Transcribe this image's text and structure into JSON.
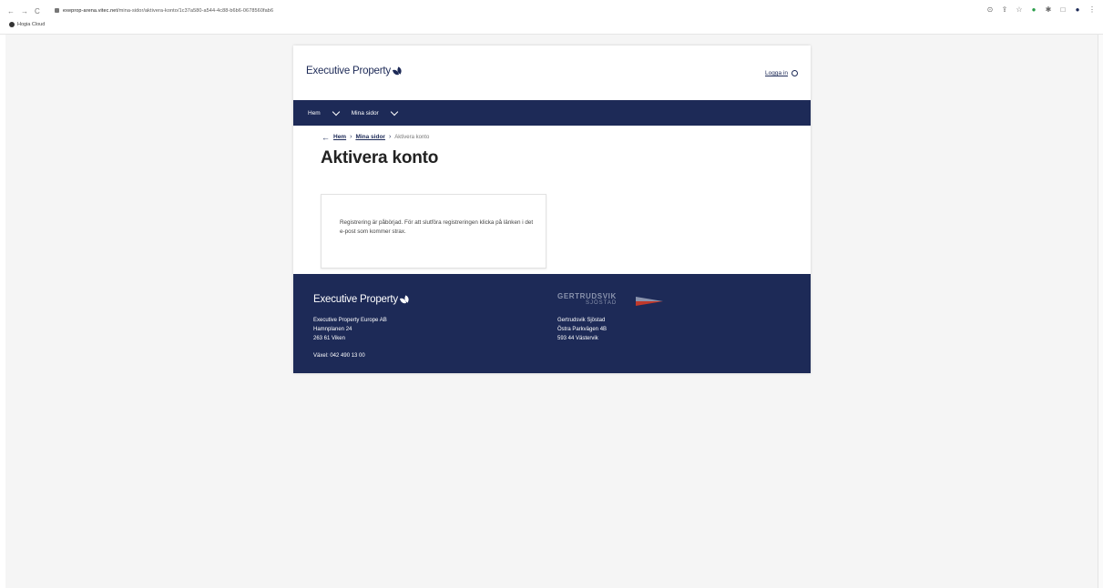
{
  "browser": {
    "url_host": "exeprop-arena.vitec.net",
    "url_path": "/mina-sidor/aktivera-konto/1c37a580-a544-4c88-b6b6-0678560fab6",
    "bookmark": "Hogia Cloud"
  },
  "header": {
    "logo_text": "Executive Property",
    "login_label": "Logga in"
  },
  "nav": {
    "items": [
      {
        "label": "Hem"
      },
      {
        "label": "Mina sidor"
      }
    ]
  },
  "breadcrumb": {
    "items": [
      "Hem",
      "Mina sidor"
    ],
    "current": "Aktivera konto"
  },
  "main": {
    "title": "Aktivera konto",
    "message": "Registrering är påbörjad. För att slutföra registreringen klicka på länken i det e-post som kommer strax."
  },
  "footer": {
    "logo_text": "Executive Property",
    "left_address": [
      "Executive Property Europe AB",
      "Hamnplanen 24",
      "263 61 Viken"
    ],
    "phone": "Växel: 042 490 13 00",
    "partner_name": "GERTRUDSVIK",
    "partner_sub": "SJÖSTAD",
    "right_address": [
      "Gertrudsvik Sjöstad",
      "Östra Parkvägen 4B",
      "593 44 Västervik"
    ]
  },
  "colors": {
    "brand_navy": "#1d2a57"
  }
}
